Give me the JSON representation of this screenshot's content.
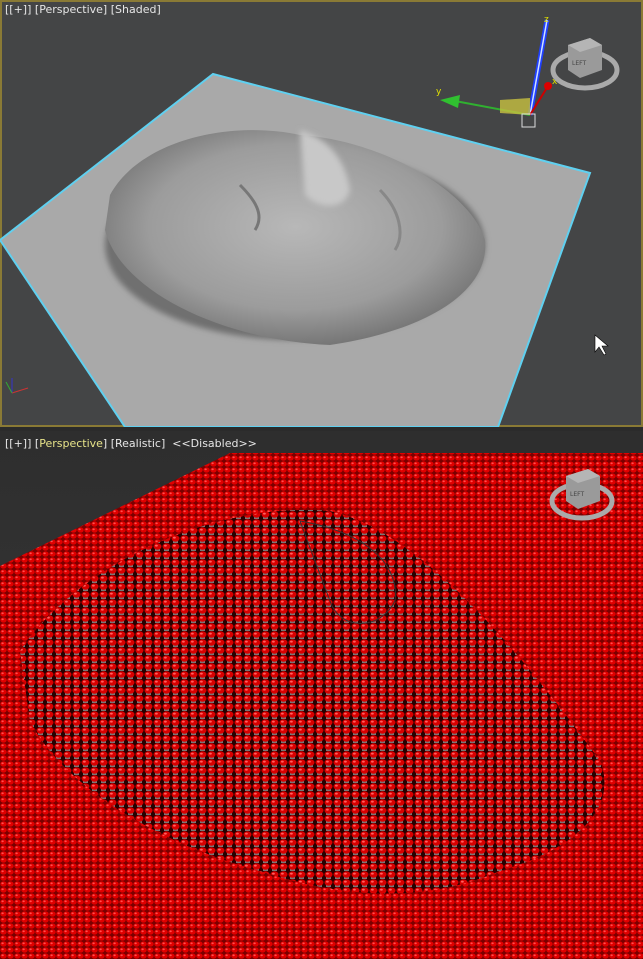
{
  "viewport_top": {
    "menu": "[+]",
    "view": "Perspective",
    "shading": "Shaded",
    "viewcube_face": "LEFT",
    "axis_x": "x",
    "axis_y": "y",
    "axis_z": "z"
  },
  "viewport_bottom": {
    "menu": "[+]",
    "view": "Perspective",
    "shading": "Realistic",
    "status": "<<Disabled>>",
    "viewcube_face": "LEFT"
  },
  "colors": {
    "active_border": "#8a7a35",
    "selection": "#5fd0f0",
    "pins": "#d00000"
  }
}
